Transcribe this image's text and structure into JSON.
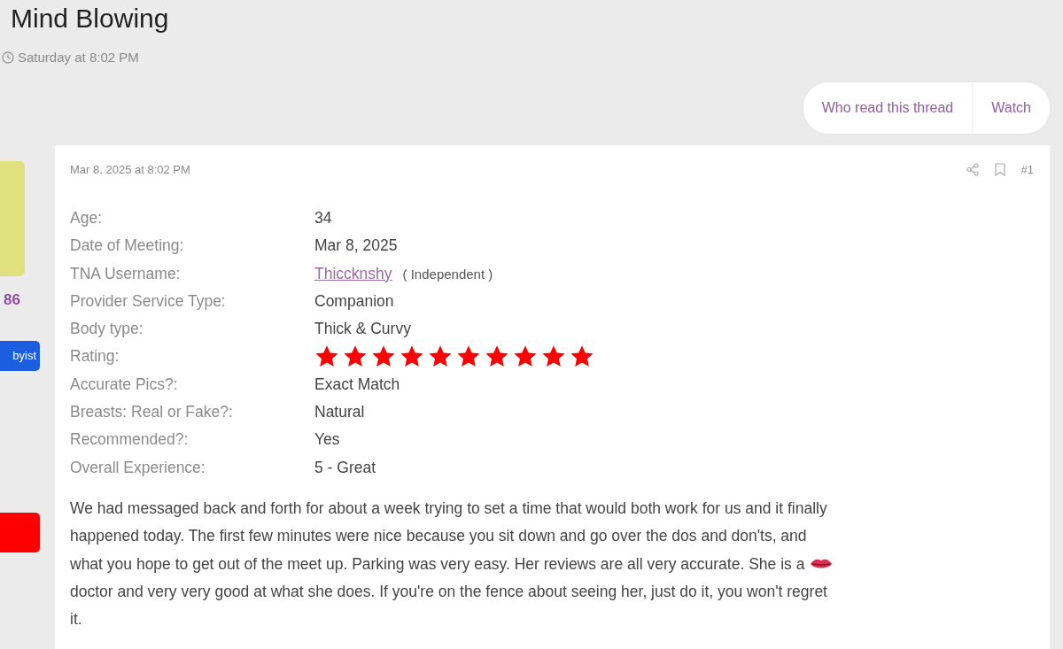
{
  "thread": {
    "title": "Mind Blowing",
    "date": "Saturday at 8:02 PM"
  },
  "thread_actions": [
    "Who read this thread",
    "Watch"
  ],
  "author_sidebar": {
    "count": "86",
    "banner": "byist"
  },
  "post": {
    "date": "Mar 8, 2025 at 8:02 PM",
    "number": "#1",
    "fields": [
      {
        "kind": "text",
        "label": "Age:",
        "value": "34"
      },
      {
        "kind": "text",
        "label": "Date of Meeting:",
        "value": "Mar 8, 2025"
      },
      {
        "kind": "user",
        "label": "TNA Username:",
        "value": "Thiccknshy",
        "note": "( Independent )"
      },
      {
        "kind": "text",
        "label": "Provider Service Type:",
        "value": "Companion"
      },
      {
        "kind": "text",
        "label": "Body type:",
        "value": "Thick & Curvy"
      },
      {
        "kind": "stars",
        "label": "Rating:",
        "stars": 10
      },
      {
        "kind": "text",
        "label": "Accurate Pics?:",
        "value": "Exact Match"
      },
      {
        "kind": "text",
        "label": "Breasts: Real or Fake?:",
        "value": "Natural"
      },
      {
        "kind": "text",
        "label": "Recommended?:",
        "value": "Yes"
      },
      {
        "kind": "text",
        "label": "Overall Experience:",
        "value": "5 - Great"
      }
    ],
    "body_lines": [
      {
        "kind": "text",
        "text": "We had messaged back and forth for about a week trying to set a time that would both work for us and it finally"
      },
      {
        "kind": "text",
        "text": "happened today. The first few minutes were nice because you sit down and go over the dos and don'ts, and"
      },
      {
        "kind": "lips",
        "text": "what you hope to get out of the meet up. Parking was very easy. Her reviews are all very accurate. She is a"
      },
      {
        "kind": "text",
        "text": "doctor and very very good at what she does. If you're on the fence about seeing her, just do it, you won't regret"
      },
      {
        "kind": "text",
        "text": "it."
      }
    ]
  }
}
